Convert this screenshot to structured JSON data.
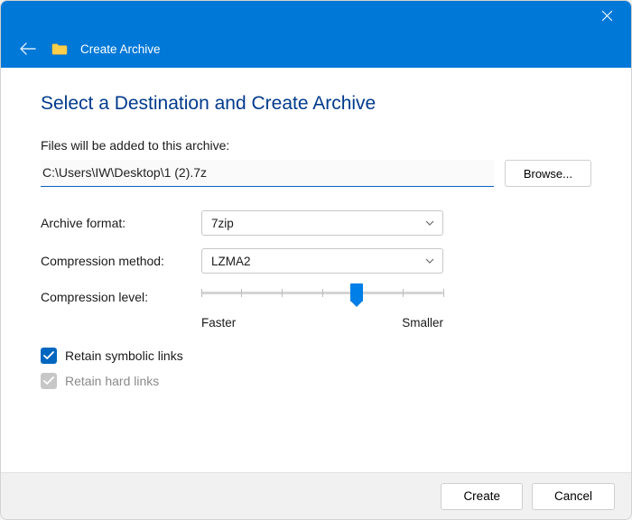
{
  "titlebar": {
    "title": "Create Archive"
  },
  "page": {
    "heading": "Select a Destination and Create Archive",
    "files_label": "Files will be added to this archive:",
    "path_value": "C:\\Users\\IW\\Desktop\\1 (2).7z",
    "browse_label": "Browse..."
  },
  "options": {
    "format_label": "Archive format:",
    "format_value": "7zip",
    "method_label": "Compression method:",
    "method_value": "LZMA2",
    "level_label": "Compression level:",
    "level_faster": "Faster",
    "level_smaller": "Smaller"
  },
  "checkboxes": {
    "symbolic_label": "Retain symbolic links",
    "hard_label": "Retain hard links"
  },
  "footer": {
    "create_label": "Create",
    "cancel_label": "Cancel"
  }
}
